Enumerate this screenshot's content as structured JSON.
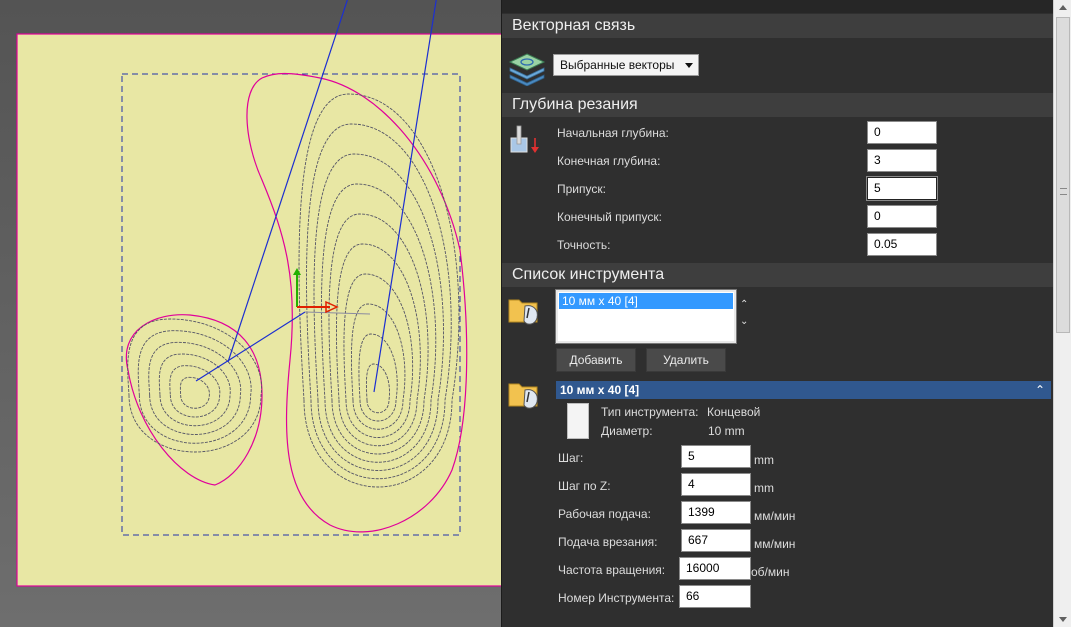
{
  "vector_link": {
    "header": "Векторная связь",
    "mode_icon": "layers-vector-icon",
    "mode_value": "Выбранные векторы"
  },
  "cut_depth": {
    "header": "Глубина резания",
    "icon": "cut-depth-icon",
    "start_depth_label": "Начальная глубина:",
    "start_depth_value": "0",
    "end_depth_label": "Конечная глубина:",
    "end_depth_value": "3",
    "allowance_label": "Припуск:",
    "allowance_value": "5",
    "final_allowance_label": "Конечный припуск:",
    "final_allowance_value": "0",
    "accuracy_label": "Точность:",
    "accuracy_value": "0.05"
  },
  "tool_list": {
    "header": "Список инструмента",
    "icon": "tool-folder-icon",
    "items": [
      "10 мм x 40 [4]"
    ],
    "add_label": "Добавить",
    "remove_label": "Удалить"
  },
  "tool_detail": {
    "title": "10 мм x 40 [4]",
    "icon": "tool-folder-icon",
    "type_label": "Тип инструмента:",
    "type_value": "Концевой",
    "diameter_label": "Диаметр:",
    "diameter_value": "10 mm",
    "step_label": "Шаг:",
    "step_value": "5",
    "step_unit": "mm",
    "zstep_label": "Шаг по Z:",
    "zstep_value": "4",
    "zstep_unit": "mm",
    "feed_label": "Рабочая подача:",
    "feed_value": "1399",
    "feed_unit": "мм/мин",
    "plunge_label": "Подача врезания:",
    "plunge_value": "667",
    "plunge_unit": "мм/мин",
    "spindle_label": "Частота вращения:",
    "spindle_value": "16000",
    "spindle_unit": "об/мин",
    "toolnum_label": "Номер Инструмента:",
    "toolnum_value": "66"
  },
  "colors": {
    "panel_bg": "#2f2f2f",
    "section_header": "#3e3e3e",
    "selection_blue": "#3399ff",
    "header_blue": "#30588f",
    "material": "#e8e7a4",
    "boundary_magenta": "#e0009a",
    "toolpath": "#555566",
    "link_blue": "#1c2fd0"
  }
}
